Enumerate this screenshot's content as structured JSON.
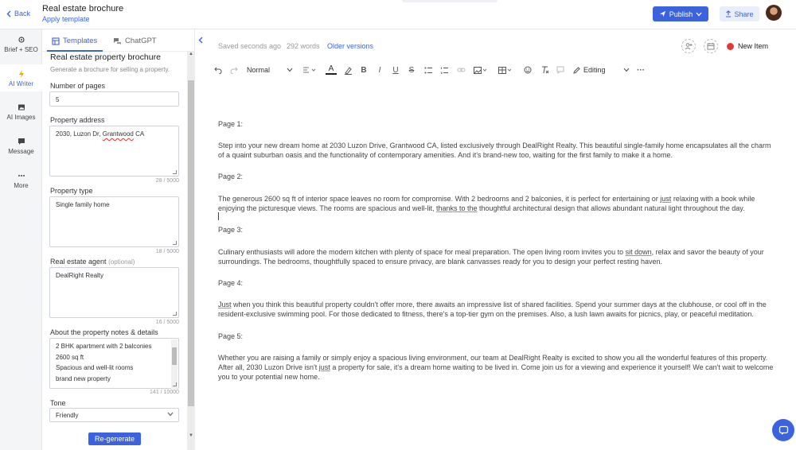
{
  "header": {
    "back_label": "Back",
    "doc_title": "Real estate brochure",
    "apply_template": "Apply template",
    "publish_label": "Publish",
    "share_label": "Share"
  },
  "rail": {
    "items": [
      {
        "label": "Brief + SEO",
        "icon": "gear-icon"
      },
      {
        "label": "AI Writer",
        "icon": "lightning-icon"
      },
      {
        "label": "AI Images",
        "icon": "image-icon"
      },
      {
        "label": "Message",
        "icon": "chat-bubble-icon"
      },
      {
        "label": "More",
        "icon": "dots-icon"
      }
    ],
    "active": "AI Writer"
  },
  "panel": {
    "tabs": [
      "Templates",
      "ChatGPT"
    ],
    "template_title": "Real estate property brochure",
    "template_subtitle": "Generate a brochure for selling a property.",
    "fields": {
      "pages": {
        "label": "Number of pages",
        "value": "5"
      },
      "address": {
        "label": "Property address",
        "value_parts": [
          "2030, Luzon Dr, ",
          "Grantwood",
          " CA"
        ],
        "count": "28 / 5000"
      },
      "type": {
        "label": "Property type",
        "value": "Single family home",
        "count": "18 / 5000"
      },
      "agent": {
        "label": "Real estate agent",
        "optional": "(optional)",
        "value": "DealRight Realty",
        "count": "16 / 5000"
      },
      "notes": {
        "label": "About the property notes & details",
        "lines": [
          "2 BHK apartment with 2 balconies",
          "2600 sq ft",
          "Spacious and well-lit rooms",
          "brand new property"
        ],
        "count": "141 / 10000"
      },
      "tone": {
        "label": "Tone",
        "value": "Friendly"
      }
    },
    "regenerate_label": "Re-generate"
  },
  "editor_bar": {
    "status": "Saved seconds ago",
    "words": "292 words",
    "older_versions": "Older versions",
    "new_item": "New Item",
    "new_item_color": "#e53935"
  },
  "toolbar": {
    "style": "Normal",
    "mode": "Editing"
  },
  "document": {
    "p1_heading": "Page 1:",
    "p1_text": "Step into your new dream home at 2030 Luzon Drive, Grantwood CA, listed exclusively through DealRight Realty. This beautiful single-family home encapsulates all the charm of a quaint suburban oasis and the functionality of contemporary amenities. And it's brand-new too, waiting for the first family to make it a home.",
    "p2_heading": "Page 2:",
    "p2_a": "The generous 2600 sq ft of interior space leaves no room for compromise. With 2 bedrooms and 2 balconies, it is perfect for entertaining or ",
    "p2_just": "just",
    "p2_b": " relaxing with a book while enjoying the picturesque views. The rooms are spacious and well-lit, ",
    "p2_thanks": "thanks to the",
    "p2_c": " thoughtful architectural design that allows abundant natural light throughout the day.",
    "p3_heading": "Page 3:",
    "p3_a": "Culinary enthusiasts will adore the modern kitchen with plenty of space for meal preparation. The open living room invites you to ",
    "p3_sit": "sit down",
    "p3_b": ", relax and savor the beauty of your surroundings. The bedrooms, thoughtfully spaced to ensure privacy, are blank canvasses ready for you to design your perfect resting haven.",
    "p4_heading": "Page 4:",
    "p4_just": "Just",
    "p4_a": " when you think this beautiful property couldn't offer more, there awaits an impressive list of shared facilities. Spend your summer days at the clubhouse, or cool off in the resident-exclusive swimming pool. For those dedicated to fitness, there's a top-tier gym on the premises. Also, a lush lawn awaits for picnics, play, or peaceful meditation.",
    "p5_heading": "Page 5:",
    "p5_a": "Whether you are raising a family or simply enjoy a spacious living environment, our team at DealRight Realty is excited to show you all the wonderful features of this property. After all, 2030 Luzon Drive isn't ",
    "p5_just": "just",
    "p5_b": " a property for sale, it's a dream home waiting to be lived in. Come join us for a viewing and experience it yourself! We can't wait to welcome you to your potential new home."
  },
  "colors": {
    "accent": "#3b63e0"
  }
}
